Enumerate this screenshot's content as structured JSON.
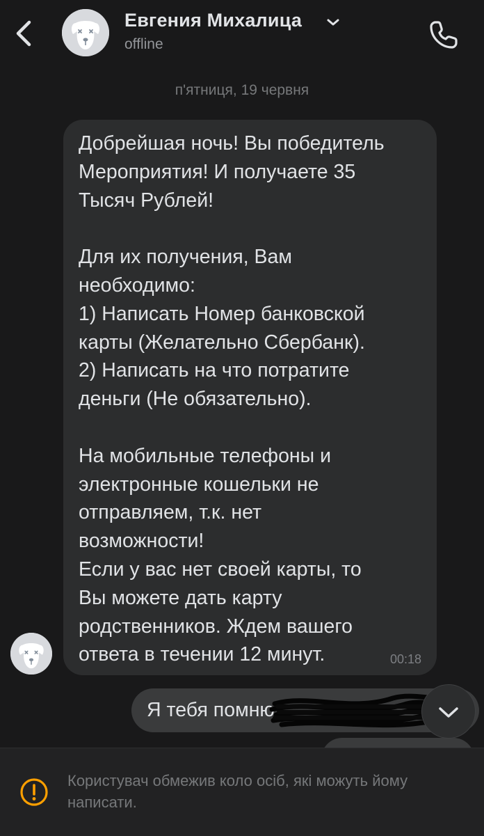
{
  "header": {
    "contact_name": "Евгения Михалица",
    "status": "offline",
    "icons": {
      "back": "chevron-left-icon",
      "name_menu": "chevron-down-icon",
      "call": "phone-icon",
      "avatar": "deactivated-dog-avatar"
    }
  },
  "chat": {
    "date_separator": "п'ятниця, 19 червня",
    "messages": [
      {
        "direction": "incoming",
        "text": "Добрейшая ночь! Вы победитель\nМероприятия! И получаете 35\nТысяч Рублей!\n\nДля их получения, Вам\nнеобходимо:\n1) Написать Номер банковской\nкарты (Желательно Сбербанк).\n2) Написать на что потратите\nденьги (Не обязательно).\n\nНа мобильные телефоны и\nэлектронные кошельки не\nотправляем, т.к. нет\nвозможности!\nЕсли у вас нет своей карты, то\nВы можете дать карту\nродственников. Ждем вашего\nответа в течении 12 минут.",
        "time": "00:18"
      },
      {
        "direction": "outgoing",
        "text": "Я тебя помню",
        "redacted": true
      }
    ]
  },
  "scroll_down_button": {
    "icon": "chevron-down-icon"
  },
  "notice": {
    "icon": "warning-circle-icon",
    "text": "Користувач обмежив коло осіб, які можуть йому написати."
  },
  "colors": {
    "background": "#19191a",
    "bubble_incoming": "#2c2d2e",
    "bubble_outgoing": "#3a3b3c",
    "text_primary": "#e1e3e6",
    "text_secondary": "#76787a",
    "warning_icon": "#ffa000"
  }
}
